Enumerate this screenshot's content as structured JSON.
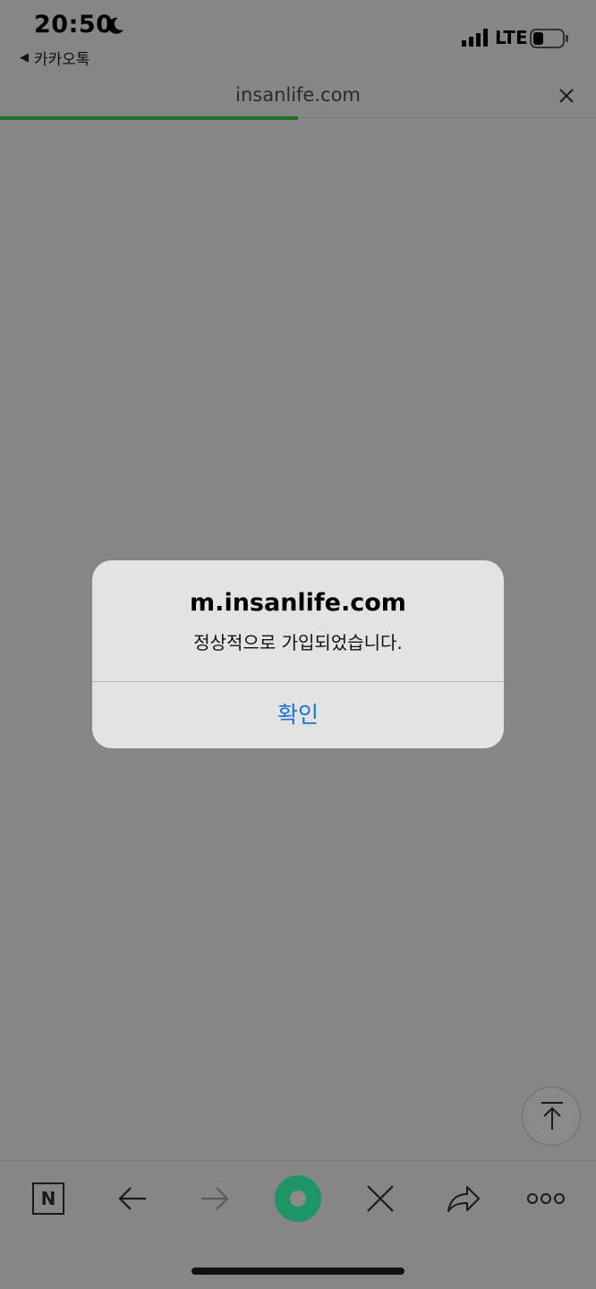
{
  "status_bar": {
    "time": "20:50",
    "back_app_label": "카카오톡",
    "network": "LTE"
  },
  "url_bar": {
    "url": "insanlife.com",
    "load_progress_percent": 50
  },
  "alert": {
    "title": "m.insanlife.com",
    "message": "정상적으로 가입되었습니다.",
    "confirm_label": "확인"
  },
  "toolbar": {
    "naver_letter": "N"
  },
  "colors": {
    "page_dim": "#868686",
    "alert_bg": "#e3e3e3",
    "accent_blue": "#1b73d8",
    "progress_green": "#1f6f2a",
    "naver_green": "#1f9466"
  },
  "icons": {
    "moon": "moon-icon",
    "signal": "signal-icon",
    "battery": "battery-icon",
    "close": "close-icon",
    "scroll_top": "arrow-up-to-top-icon",
    "back": "arrow-left-icon",
    "forward": "arrow-right-icon",
    "stop": "close-icon",
    "share": "share-icon",
    "more": "more-icon"
  }
}
